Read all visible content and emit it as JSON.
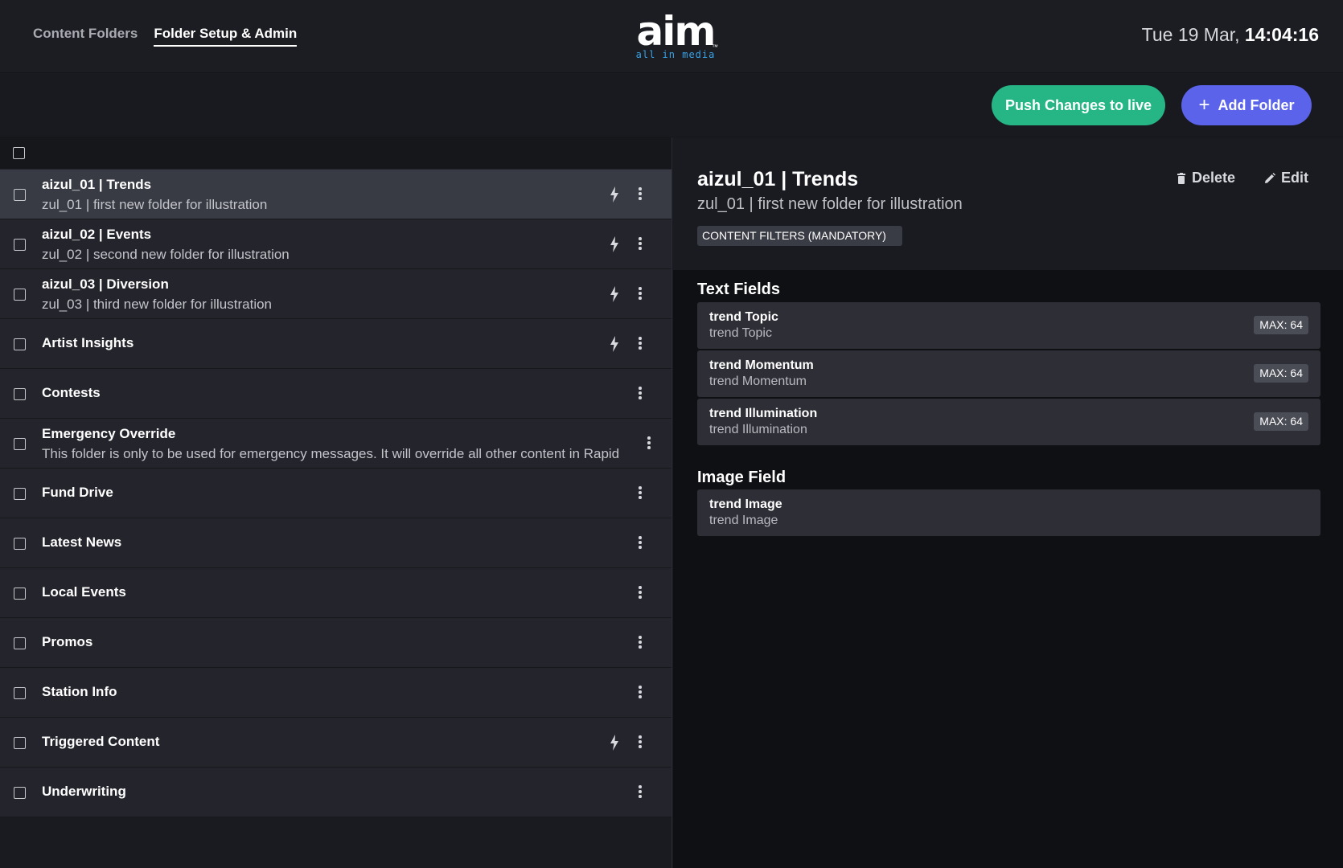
{
  "header": {
    "nav": [
      {
        "label": "Content Folders",
        "active": false
      },
      {
        "label": "Folder Setup & Admin",
        "active": true
      }
    ],
    "logo": {
      "word": "aim",
      "tagline": "all in media",
      "tm": "™"
    },
    "clock": {
      "date": "Tue 19 Mar,",
      "time": "14:04:16"
    }
  },
  "actions": {
    "push_label": "Push Changes to live",
    "add_label": "Add Folder",
    "add_icon": "+"
  },
  "folders": [
    {
      "title": "aizul_01 | Trends",
      "sub": "zul_01 | first new folder for illustration",
      "bolt": true,
      "selected": true
    },
    {
      "title": "aizul_02 | Events",
      "sub": "zul_02 | second new folder for illustration",
      "bolt": true
    },
    {
      "title": "aizul_03 | Diversion",
      "sub": "zul_03 | third new folder for illustration",
      "bolt": true
    },
    {
      "title": "Artist Insights",
      "sub": "",
      "bolt": true
    },
    {
      "title": "Contests",
      "sub": "",
      "bolt": false
    },
    {
      "title": "Emergency Override",
      "sub": "This folder is only to be used for emergency messages. It will override all other content in Rapid",
      "bolt": false
    },
    {
      "title": "Fund Drive",
      "sub": "",
      "bolt": false
    },
    {
      "title": "Latest News",
      "sub": "",
      "bolt": false
    },
    {
      "title": "Local Events",
      "sub": "",
      "bolt": false
    },
    {
      "title": "Promos",
      "sub": "",
      "bolt": false
    },
    {
      "title": "Station Info",
      "sub": "",
      "bolt": false
    },
    {
      "title": "Triggered Content",
      "sub": "",
      "bolt": true
    },
    {
      "title": "Underwriting",
      "sub": "",
      "bolt": false
    }
  ],
  "detail": {
    "title": "aizul_01 | Trends",
    "subtitle": "zul_01 | first new folder for illustration",
    "badge": "CONTENT FILTERS (MANDATORY)",
    "delete_label": "Delete",
    "edit_label": "Edit",
    "text_fields_title": "Text Fields",
    "text_fields": [
      {
        "name": "trend Topic",
        "sub": "trend Topic",
        "max": "MAX: 64"
      },
      {
        "name": "trend Momentum",
        "sub": "trend Momentum",
        "max": "MAX: 64"
      },
      {
        "name": "trend Illumination",
        "sub": "trend Illumination",
        "max": "MAX: 64"
      }
    ],
    "image_field_title": "Image Field",
    "image_fields": [
      {
        "name": "trend Image",
        "sub": "trend Image"
      }
    ]
  },
  "colors": {
    "push": "#26b686",
    "add": "#5a63ea",
    "logo_tagline": "#38a3e8"
  }
}
